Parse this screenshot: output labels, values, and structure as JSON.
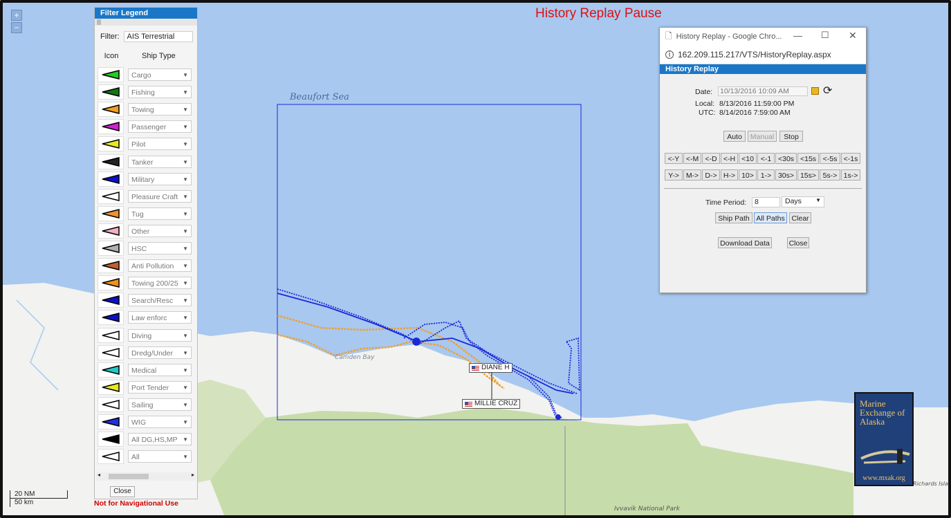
{
  "map": {
    "title": "History Replay Pause",
    "zoom_in": "+",
    "zoom_out": "−",
    "sea_label": "Beaufort Sea",
    "bay_label": "Camden Bay",
    "park_label": "Ivvavik National Park",
    "island_label": "Richards Isla",
    "ships": [
      {
        "name": "DIANE H"
      },
      {
        "name": "MILLIE CRUZ"
      }
    ],
    "scale": {
      "nm": "20 NM",
      "km": "50 km"
    },
    "disclaimer": "Not for Navigational Use"
  },
  "legend": {
    "title": "Filter Legend",
    "filter_label": "Filter:",
    "filter_value": "AIS Terrestrial",
    "col_icon": "Icon",
    "col_type": "Ship Type",
    "close": "Close",
    "items": [
      {
        "label": "Cargo",
        "color": "#22cc22"
      },
      {
        "label": "Fishing",
        "color": "#117711"
      },
      {
        "label": "Towing",
        "color": "#f0a020"
      },
      {
        "label": "Passenger",
        "color": "#d020d0"
      },
      {
        "label": "Pilot",
        "color": "#e8e820"
      },
      {
        "label": "Tanker",
        "color": "#222222"
      },
      {
        "label": "Military",
        "color": "#0a10c8"
      },
      {
        "label": "Pleasure Craft",
        "color": "#ffffff"
      },
      {
        "label": "Tug",
        "color": "#f09030"
      },
      {
        "label": "Other",
        "color": "#f0b0c0"
      },
      {
        "label": "HSC",
        "color": "#b0b0b0"
      },
      {
        "label": "Anti Pollution",
        "color": "#c06030"
      },
      {
        "label": "Towing 200/25",
        "color": "#f09020"
      },
      {
        "label": "Search/Resc",
        "color": "#0a10c8"
      },
      {
        "label": "Law enforc",
        "color": "#0a10c8"
      },
      {
        "label": "Diving",
        "color": "#ffffff"
      },
      {
        "label": "Dredg/Under",
        "color": "#ffffff"
      },
      {
        "label": "Medical",
        "color": "#20c8c8"
      },
      {
        "label": "Port Tender",
        "color": "#e8e820"
      },
      {
        "label": "Sailing",
        "color": "#ffffff"
      },
      {
        "label": "WIG",
        "color": "#2030e0"
      },
      {
        "label": "All DG,HS,MP",
        "color": "#000000"
      },
      {
        "label": "All",
        "color": "#ffffff"
      }
    ]
  },
  "dialog": {
    "window_title": "History Replay - Google Chro...",
    "url": "162.209.115.217/VTS/HistoryReplay.aspx",
    "header": "History Replay",
    "date_label": "Date:",
    "date_value": "10/13/2016 10:09 AM",
    "local_label": "Local:",
    "local_value": "8/13/2016 11:59:00 PM",
    "utc_label": "UTC:",
    "utc_value": "8/14/2016 7:59:00 AM",
    "mode_buttons": [
      "Auto",
      "Manual",
      "Stop"
    ],
    "back_buttons": [
      "<-Y",
      "<-M",
      "<-D",
      "<-H",
      "<10",
      "<-1",
      "<30s",
      "<15s",
      "<-5s",
      "<-1s"
    ],
    "fwd_buttons": [
      "Y->",
      "M->",
      "D->",
      "H->",
      "10>",
      "1->",
      "30s>",
      "15s>",
      "5s->",
      "1s->"
    ],
    "period_label": "Time Period:",
    "period_value": "8",
    "period_unit": "Days",
    "path_buttons": [
      "Ship Path",
      "All Paths",
      "Clear"
    ],
    "download": "Download Data",
    "close": "Close"
  },
  "logo": {
    "text": "Marine Exchange of Alaska",
    "url": "www.mxak.org"
  },
  "colors": {
    "sea": "#a8c8f0",
    "land": "#f2f2f0",
    "park": "#c7dcab",
    "track_blue": "#1a28d8",
    "track_orange": "#f0a030",
    "accent": "#1a77c8",
    "alert": "#d11111"
  }
}
